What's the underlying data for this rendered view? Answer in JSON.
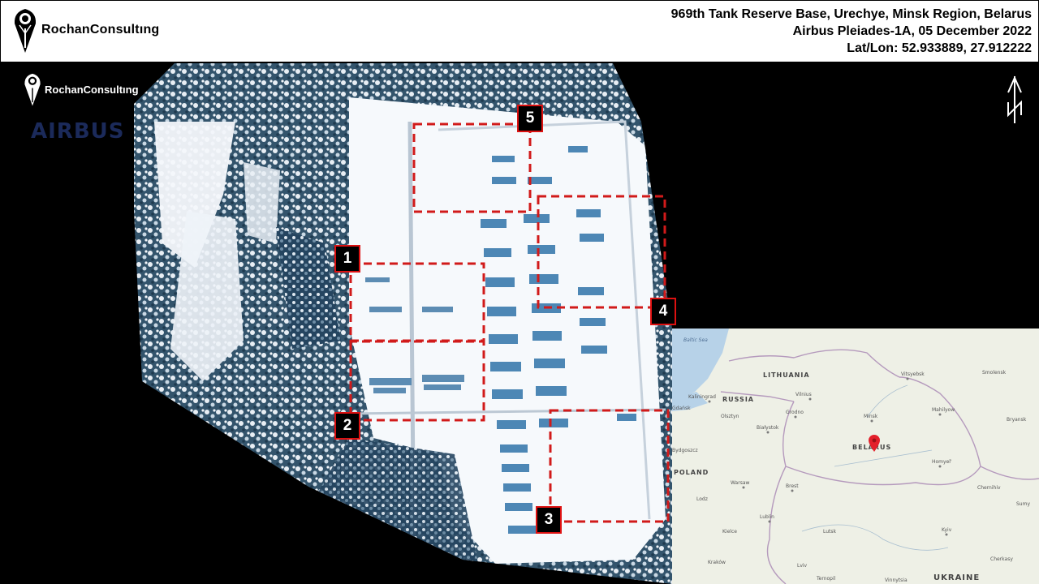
{
  "header": {
    "brand_name": "RochanConsultıng",
    "lines": [
      "969th Tank Reserve Base, Urechye, Minsk Region, Belarus",
      "Airbus Pleiades-1A, 05 December 2022",
      "Lat/Lon:  52.933889, 27.912222"
    ]
  },
  "overlay": {
    "brand_name": "RochanConsultıng",
    "airbus_logo": "AIRBUS",
    "north_arrow_icon": "north-arrow-icon"
  },
  "markers": [
    {
      "id": "1",
      "label": "1"
    },
    {
      "id": "2",
      "label": "2"
    },
    {
      "id": "3",
      "label": "3"
    },
    {
      "id": "4",
      "label": "4"
    },
    {
      "id": "5",
      "label": "5"
    }
  ],
  "inset_map": {
    "countries": [
      "LITHUANIA",
      "RUSSIA",
      "BELARUS",
      "POLAND",
      "UKRAINE"
    ],
    "seas": [
      "Baltic Sea"
    ],
    "cities": [
      "Kaliningrad",
      "Vilnius",
      "Minsk",
      "Mahilyow",
      "Vitsyebsk",
      "Smolensk",
      "Bryansk",
      "Gdańsk",
      "Białystok",
      "Grodno",
      "Homyel'",
      "Warsaw",
      "Brest",
      "Lodz",
      "Lublin",
      "Lutsk",
      "Kielce",
      "Kraków",
      "Lviv",
      "Ternopil",
      "Kyiv",
      "Sumy",
      "Chernihiv",
      "Cherkasy",
      "Vinnytsia",
      "Olsztyn",
      "Bydgoszcz"
    ],
    "marker_icon": "location-pin-icon"
  },
  "colors": {
    "annotation_red": "#d11a1a",
    "header_bg": "#ffffff",
    "snow": "#f4f7fb",
    "forest": "#2e4f66",
    "inset_land": "#eef0e6",
    "inset_water": "#b7d2e8",
    "pin": "#e3202b"
  }
}
